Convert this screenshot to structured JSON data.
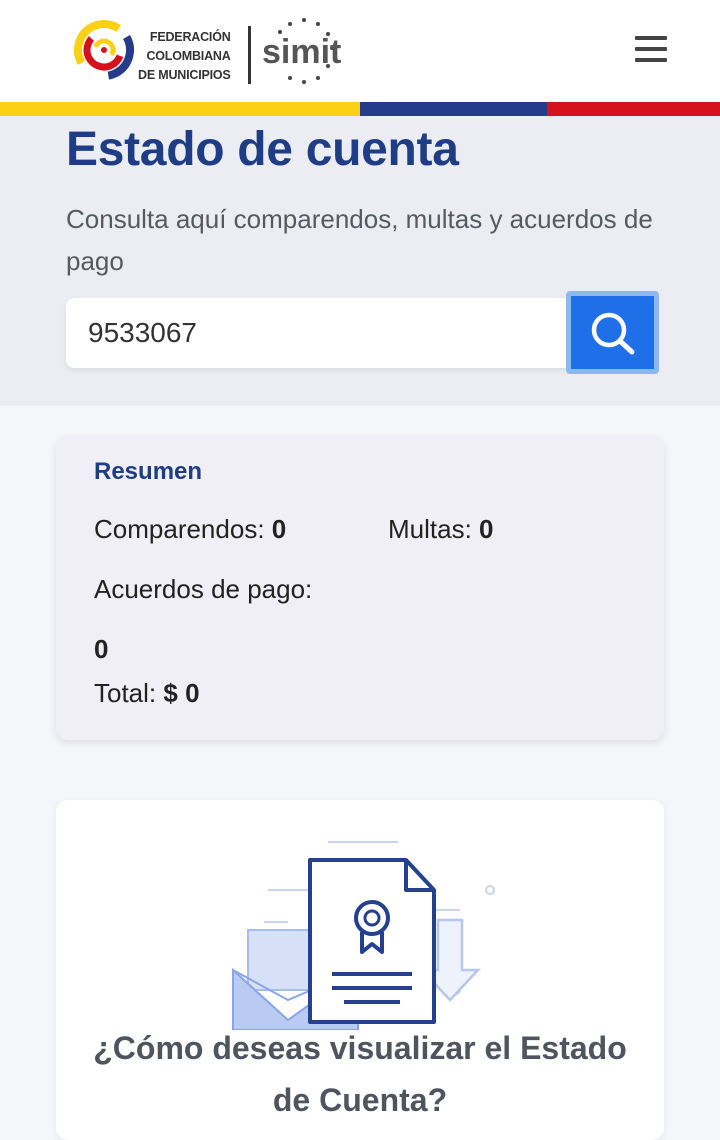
{
  "header": {
    "org_lines": [
      "FEDERACIÓN",
      "COLOMBIANA",
      "DE MUNICIPIOS"
    ],
    "brand": "simit",
    "menu_icon": "hamburger-menu-icon"
  },
  "flag_colors": [
    "#fcd115",
    "#243c8a",
    "#d4111d"
  ],
  "hero": {
    "title": "Estado de cuenta",
    "subtitle": "Consulta aquí comparendos, multas y acuerdos de pago"
  },
  "search": {
    "value": "9533067",
    "button_icon": "search-icon"
  },
  "summary": {
    "title": "Resumen",
    "comparendos_label": "Comparendos:",
    "comparendos_value": "0",
    "multas_label": "Multas:",
    "multas_value": "0",
    "acuerdos_label": "Acuerdos de pago:",
    "acuerdos_value": "0",
    "total_label": "Total:",
    "total_value": "$ 0"
  },
  "options": {
    "illustration": "document-certificate-envelope-download-icon",
    "question": "¿Cómo deseas visualizar el Estado de Cuenta?"
  },
  "colors": {
    "primary_blue": "#1f3d84",
    "button_blue": "#1f6fe8"
  }
}
